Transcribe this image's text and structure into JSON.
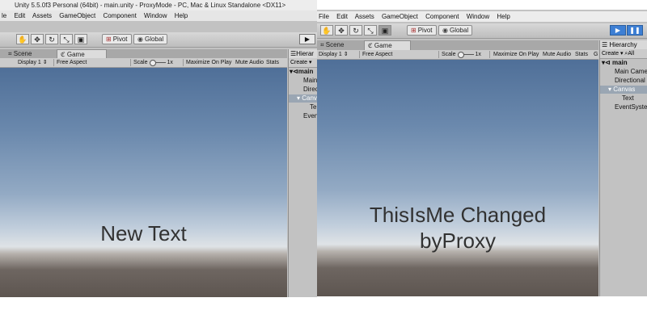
{
  "left": {
    "title": "Unity 5.5.0f3 Personal (64bit) - main.unity - ProxyMode - PC, Mac & Linux Standalone <DX11>",
    "menu": [
      "le",
      "Edit",
      "Assets",
      "GameObject",
      "Component",
      "Window",
      "Help"
    ],
    "toolbar": {
      "pivot": "Pivot",
      "global": "Global"
    },
    "tabs": {
      "scene": "Scene",
      "game": "Game"
    },
    "gamebar": {
      "display": "Display 1",
      "aspect": "Free Aspect",
      "scale": "Scale",
      "scale_value": "1x",
      "maximize": "Maximize On Play",
      "mute": "Mute Audio",
      "stats": "Stats"
    },
    "hierarchy": {
      "title": "Hierar",
      "create": "Create",
      "scene": "main",
      "items": [
        "Main",
        "Direc",
        "Canv",
        "Te",
        "Even"
      ]
    },
    "game_text": "New Text"
  },
  "right": {
    "menu": [
      "File",
      "Edit",
      "Assets",
      "GameObject",
      "Component",
      "Window",
      "Help"
    ],
    "toolbar": {
      "pivot": "Pivot",
      "global": "Global"
    },
    "tabs": {
      "scene": "Scene",
      "game": "Game"
    },
    "gamebar": {
      "display": "Display 1",
      "aspect": "Free Aspect",
      "scale": "Scale",
      "scale_value": "1x",
      "maximize": "Maximize On Play",
      "mute": "Mute Audio",
      "stats": "Stats",
      "gizmos": "G"
    },
    "hierarchy": {
      "title": "Hierarchy",
      "create": "Create",
      "search": "All",
      "scene": "main",
      "items": [
        "Main Camer",
        "Directional",
        "Canvas",
        "Text",
        "EventSyster"
      ]
    },
    "game_text_line1": "ThisIsMe Changed",
    "game_text_line2": "byProxy"
  }
}
